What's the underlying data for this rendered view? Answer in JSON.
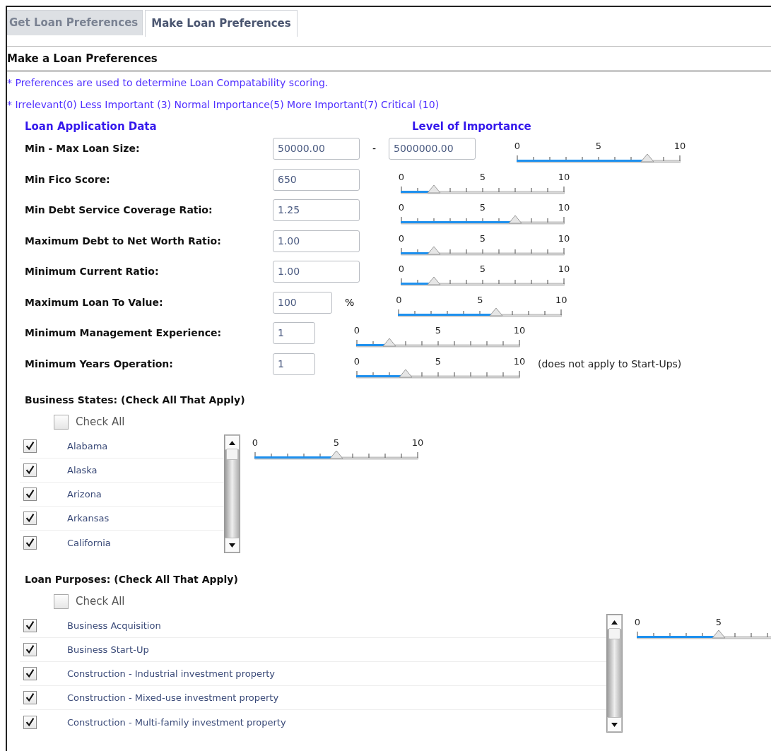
{
  "tabs": [
    {
      "label": "Get Loan Preferences",
      "selected": false
    },
    {
      "label": "Make Loan Preferences",
      "selected": true
    }
  ],
  "heading": "Make a Loan Preferences",
  "notes": [
    "* Preferences are used to determine Loan Compatability scoring.",
    "* Irrelevant(0) Less Important (3) Normal Importance(5) More Important(7) Critical (10)"
  ],
  "columns": {
    "data": "Loan Application Data",
    "importance": "Level of Importance"
  },
  "criteria": [
    {
      "kind": "range",
      "label": "Min - Max Loan Size:",
      "inputs": [
        "50000.00",
        "5000000.00"
      ],
      "separator": "-",
      "slider": {
        "level": 0.8,
        "tick_labels": [
          "0",
          "5",
          "10"
        ]
      }
    },
    {
      "kind": "amount",
      "label": "Min Fico Score:",
      "inputs": [
        "650"
      ],
      "slider": {
        "level": 0.2,
        "tick_labels": [
          "0",
          "5",
          "10"
        ]
      }
    },
    {
      "kind": "amount",
      "label": "Min Debt Service Coverage Ratio:",
      "inputs": [
        "1.25"
      ],
      "slider": {
        "level": 0.7,
        "tick_labels": [
          "0",
          "5",
          "10"
        ]
      }
    },
    {
      "kind": "amount",
      "label": "Maximum Debt to Net Worth Ratio:",
      "inputs": [
        "1.00"
      ],
      "slider": {
        "level": 0.2,
        "tick_labels": [
          "0",
          "5",
          "10"
        ]
      }
    },
    {
      "kind": "amount",
      "label": "Minimum Current Ratio:",
      "inputs": [
        "1.00"
      ],
      "slider": {
        "level": 0.2,
        "tick_labels": [
          "0",
          "5",
          "10"
        ]
      }
    },
    {
      "kind": "percent",
      "label": "Maximum Loan To Value:",
      "inputs": [
        "100"
      ],
      "suffix": "%",
      "slider": {
        "level": 0.6,
        "tick_labels": [
          "0",
          "5",
          "10"
        ]
      }
    },
    {
      "kind": "years",
      "label": "Minimum Management Experience:",
      "inputs": [
        "1"
      ],
      "slider": {
        "level": 0.2,
        "tick_labels": [
          "0",
          "5",
          "10"
        ]
      }
    },
    {
      "kind": "years",
      "label": "Minimum Years Operation:",
      "inputs": [
        "1"
      ],
      "note": "(does not apply to Start-Ups)",
      "slider": {
        "level": 0.3,
        "tick_labels": [
          "0",
          "5",
          "10"
        ]
      }
    }
  ],
  "business_states": {
    "heading": "Business States: (Check All That Apply)",
    "check_all": {
      "label": "Check All",
      "checked": false
    },
    "items": [
      {
        "label": "Alabama",
        "checked": true
      },
      {
        "label": "Alaska",
        "checked": true
      },
      {
        "label": "Arizona",
        "checked": true
      },
      {
        "label": "Arkansas",
        "checked": true
      },
      {
        "label": "California",
        "checked": true
      }
    ],
    "slider": {
      "level": 0.5,
      "tick_labels": [
        "0",
        "5",
        "10"
      ]
    }
  },
  "loan_purposes": {
    "heading": "Loan Purposes: (Check All That Apply)",
    "check_all": {
      "label": "Check All",
      "checked": false
    },
    "items": [
      {
        "label": "Business Acquisition",
        "checked": true
      },
      {
        "label": "Business Start-Up",
        "checked": true
      },
      {
        "label": "Construction - Industrial investment property",
        "checked": true
      },
      {
        "label": "Construction - Mixed-use investment property",
        "checked": true
      },
      {
        "label": "Construction - Multi-family investment property",
        "checked": true
      }
    ],
    "slider": {
      "level": 0.5,
      "tick_labels": [
        "0",
        "5"
      ]
    }
  }
}
